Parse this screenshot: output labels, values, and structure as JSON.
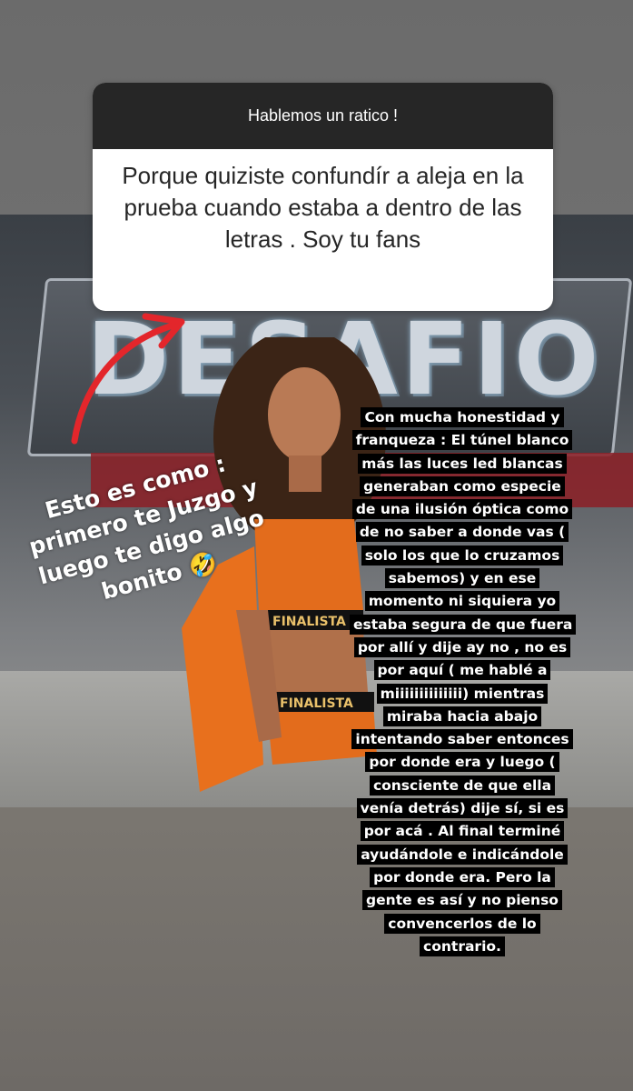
{
  "question_sticker": {
    "title": "Hablemos un ratico !",
    "question": "Porque quiziste confundír a aleja en la prueba cuando estaba a dentro de las letras . Soy tu fans"
  },
  "photo": {
    "sign_text": "DESAFIO",
    "belt_text": "FINALISTA"
  },
  "caption_left": "Esto es como : primero te Juzgo y luego te digo algo bonito 🤣",
  "reply_text": "Con mucha honestidad y franqueza : El túnel blanco más las luces led blancas generaban como especie de una ilusión óptica como de no saber a donde vas ( solo los que lo cruzamos sabemos) y en ese momento ni siquiera yo estaba segura de que fuera por allí y dije ay no , no es por aquí ( me hablé a miiiiiiiiiiiiii) mientras miraba hacia abajo intentando saber entonces por donde era y luego ( consciente de que ella venía detrás) dije sí, si es por acá . Al final terminé ayudándole e indicándole por donde era. Pero la gente es así y no pienso convencerlos de lo contrario.",
  "colors": {
    "arrow": "#e3262b",
    "sticker_header": "#262626",
    "text_bg": "#000000"
  }
}
